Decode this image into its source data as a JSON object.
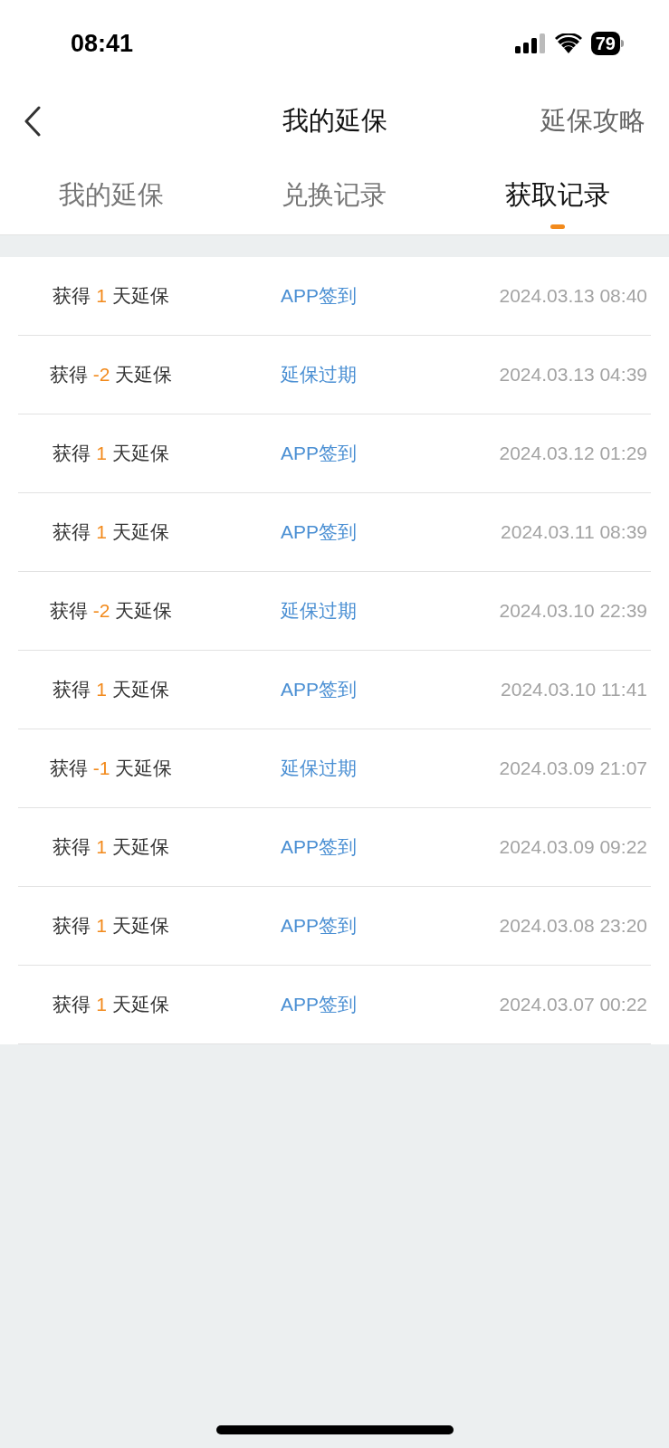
{
  "status_bar": {
    "time": "08:41",
    "battery": "79"
  },
  "header": {
    "title": "我的延保",
    "action": "延保攻略"
  },
  "tabs": [
    {
      "label": "我的延保",
      "selected": false
    },
    {
      "label": "兑换记录",
      "selected": false
    },
    {
      "label": "获取记录",
      "selected": true
    }
  ],
  "records": [
    {
      "prefix": "获得",
      "amount": "1",
      "unit": "天延保",
      "source": "APP签到",
      "time": "2024.03.13 08:40"
    },
    {
      "prefix": "获得",
      "amount": "-2",
      "unit": "天延保",
      "source": "延保过期",
      "time": "2024.03.13 04:39"
    },
    {
      "prefix": "获得",
      "amount": "1",
      "unit": "天延保",
      "source": "APP签到",
      "time": "2024.03.12 01:29"
    },
    {
      "prefix": "获得",
      "amount": "1",
      "unit": "天延保",
      "source": "APP签到",
      "time": "2024.03.11 08:39"
    },
    {
      "prefix": "获得",
      "amount": "-2",
      "unit": "天延保",
      "source": "延保过期",
      "time": "2024.03.10 22:39"
    },
    {
      "prefix": "获得",
      "amount": "1",
      "unit": "天延保",
      "source": "APP签到",
      "time": "2024.03.10 11:41"
    },
    {
      "prefix": "获得",
      "amount": "-1",
      "unit": "天延保",
      "source": "延保过期",
      "time": "2024.03.09 21:07"
    },
    {
      "prefix": "获得",
      "amount": "1",
      "unit": "天延保",
      "source": "APP签到",
      "time": "2024.03.09 09:22"
    },
    {
      "prefix": "获得",
      "amount": "1",
      "unit": "天延保",
      "source": "APP签到",
      "time": "2024.03.08 23:20"
    },
    {
      "prefix": "获得",
      "amount": "1",
      "unit": "天延保",
      "source": "APP签到",
      "time": "2024.03.07 00:22"
    }
  ]
}
